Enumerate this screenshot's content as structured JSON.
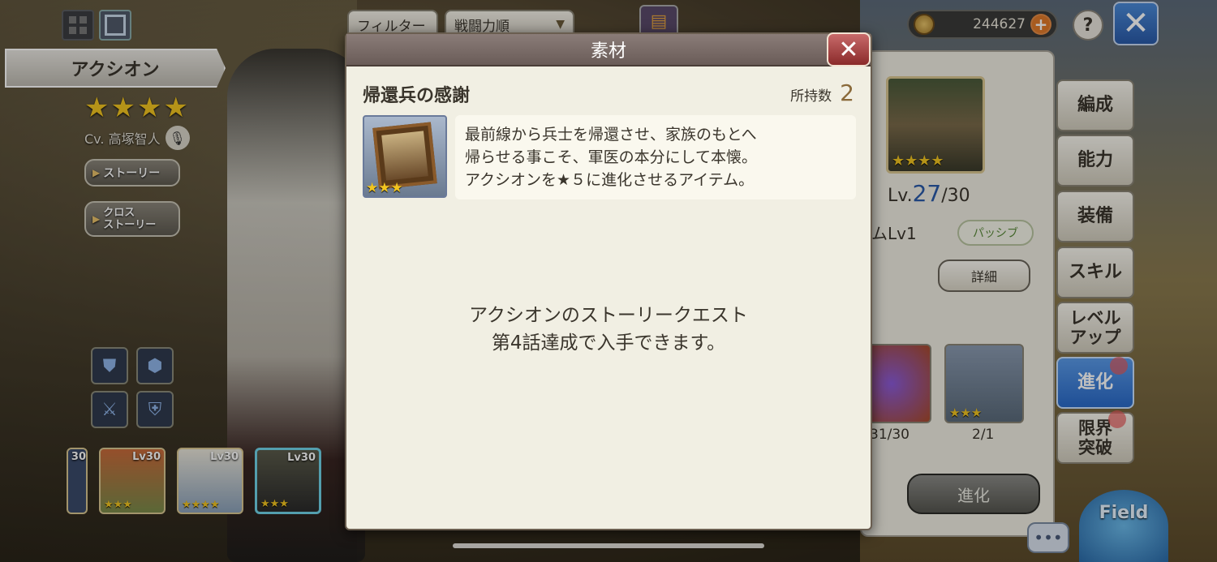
{
  "header": {
    "filter_label": "フィルター",
    "sort_label": "戦闘力順",
    "coins": "244627",
    "help_label": "?"
  },
  "character": {
    "name": "アクシオン",
    "rarity_stars": 4,
    "cv": "Cv. 高塚智人",
    "story_label": "ストーリー",
    "cross_story_line1": "クロス",
    "cross_story_line2": "ストーリー"
  },
  "roster": [
    {
      "level": "30",
      "stars": "★★★"
    },
    {
      "level": "Lv30",
      "stars": "★★★"
    },
    {
      "level": "Lv30",
      "stars": "★★★★"
    },
    {
      "level": "Lv30",
      "stars": "★★★"
    }
  ],
  "info_panel": {
    "level_prefix": "Lv.",
    "level_current": "27",
    "level_max": "/30",
    "skill_lv": "ムLv1",
    "passive_label": "パッシブ",
    "detail_label": "詳細",
    "mat1_count": "31/30",
    "mat2_count": "2/1",
    "evolve_button": "進化"
  },
  "right_tabs": [
    {
      "label": "編成"
    },
    {
      "label": "能力"
    },
    {
      "label": "装備"
    },
    {
      "label": "スキル"
    },
    {
      "label": "レベル\nアップ"
    },
    {
      "label": "進化"
    },
    {
      "label": "限界\n突破"
    }
  ],
  "field_label": "Field",
  "modal": {
    "title": "素材",
    "item_name": "帰還兵の感謝",
    "owned_label": "所持数",
    "owned_value": "2",
    "item_stars": "★★★",
    "description": [
      "最前線から兵士を帰還させ、家族のもとへ",
      "帰らせる事こそ、軍医の本分にして本懐。",
      "アクシオンを★５に進化させるアイテム。"
    ],
    "acquire": [
      "アクシオンのストーリークエスト",
      "第4話達成で入手できます。"
    ]
  },
  "colors": {
    "modal_header": "#7a6c68",
    "modal_close": "#a84a4a",
    "active_tab": "#3a7ad8",
    "owned_value": "#8a6a3a",
    "star": "#f2c520"
  }
}
